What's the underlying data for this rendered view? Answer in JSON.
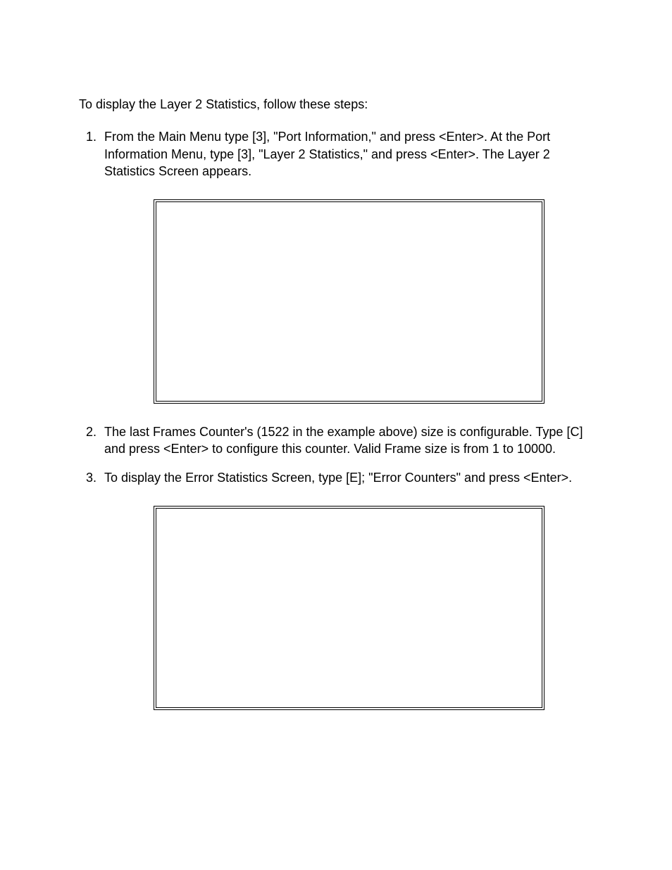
{
  "intro": "To display the Layer 2 Statistics, follow these steps:",
  "steps": {
    "s1": {
      "pre1": "From the Main Menu type [",
      "key1": "3",
      "post1": "], \"Port Information,\" and press <Enter>.  At the Port Information Menu, type [",
      "key2": "3",
      "post2": "], \"Layer 2 Statistics,\" and press <Enter>.  The Layer 2 Statistics Screen appears."
    },
    "s2": {
      "pre1": "The last Frames Counter's (1522 in the example above) size is configurable.  Type [",
      "key1": "C",
      "post1": "] and press <Enter> to configure this counter.  Valid Frame size is from 1 to 10000."
    },
    "s3": {
      "pre1": "To display the Error Statistics Screen, type [",
      "key1": "E",
      "post1": "]; \"Error Counters\" and press <Enter>."
    }
  }
}
